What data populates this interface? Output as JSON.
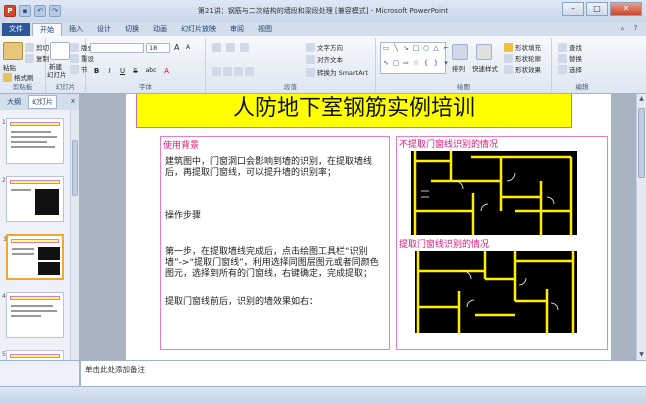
{
  "window": {
    "title": "第21讲：钢筋与二次结构的墙段和梁段处理 [兼容模式] - Microsoft PowerPoint"
  },
  "quick_access": {
    "app_icon": "P",
    "save_icon": "save-icon",
    "undo_icon": "undo-icon",
    "redo_icon": "redo-icon"
  },
  "window_controls": {
    "minimize": "–",
    "maximize": "□",
    "close": "✕"
  },
  "tabs": [
    "开始",
    "插入",
    "设计",
    "切换",
    "动画",
    "幻灯片放映",
    "审阅",
    "视图"
  ],
  "file_tab": "文件",
  "ribbon": {
    "clipboard": {
      "label": "剪贴板",
      "paste": "粘贴",
      "cut": "剪切",
      "copy": "复制",
      "format_painter": "格式刷"
    },
    "slides": {
      "label": "幻灯片",
      "new_slide": "新建",
      "new_slide_sub": "幻灯片",
      "layout": "版式",
      "reset": "重设",
      "section": "节"
    },
    "font": {
      "label": "字体",
      "font_size": "18",
      "bold": "B",
      "italic": "I",
      "underline": "U",
      "strike": "S",
      "shadow": "abc",
      "grow": "A",
      "shrink": "A"
    },
    "paragraph": {
      "label": "段落",
      "text_direction": "文字方向",
      "align_text": "对齐文本",
      "smartart": "转换为 SmartArt"
    },
    "drawing": {
      "label": "绘图",
      "arrange": "排列",
      "quick_styles": "快速样式",
      "shape_fill": "形状填充",
      "shape_outline": "形状轮廓",
      "shape_effects": "形状效果"
    },
    "editing": {
      "label": "编辑",
      "find": "查找",
      "replace": "替换",
      "select": "选择"
    }
  },
  "panel": {
    "tab_outline": "大纲",
    "tab_slides": "幻灯片",
    "close": "x",
    "thumbnail_numbers": [
      "1",
      "2",
      "3",
      "4",
      "5"
    ]
  },
  "slide": {
    "title": "人防地下室钢筋实例培训",
    "left_heading": "使用背景",
    "left_p1": "建筑图中，门窗洞口会影响到墙的识别，在提取墙线后，再提取门窗线，可以提升墙的识别率；",
    "left_p2": "操作步骤",
    "left_p3": "第一步，在提取墙线完成后，点击绘图工具栏“识别墙”->“提取门窗线”，利用选择同图层图元或者同颜色图元，选择到所有的门窗线，右键确定，完成提取；",
    "left_p4": "提取门窗线前后，识别的墙效果如右：",
    "right_heading_1": "不提取门窗线识别的情况",
    "right_heading_2": "提取门窗线识别的情况"
  },
  "notes": {
    "placeholder": "单击此处添加备注"
  }
}
